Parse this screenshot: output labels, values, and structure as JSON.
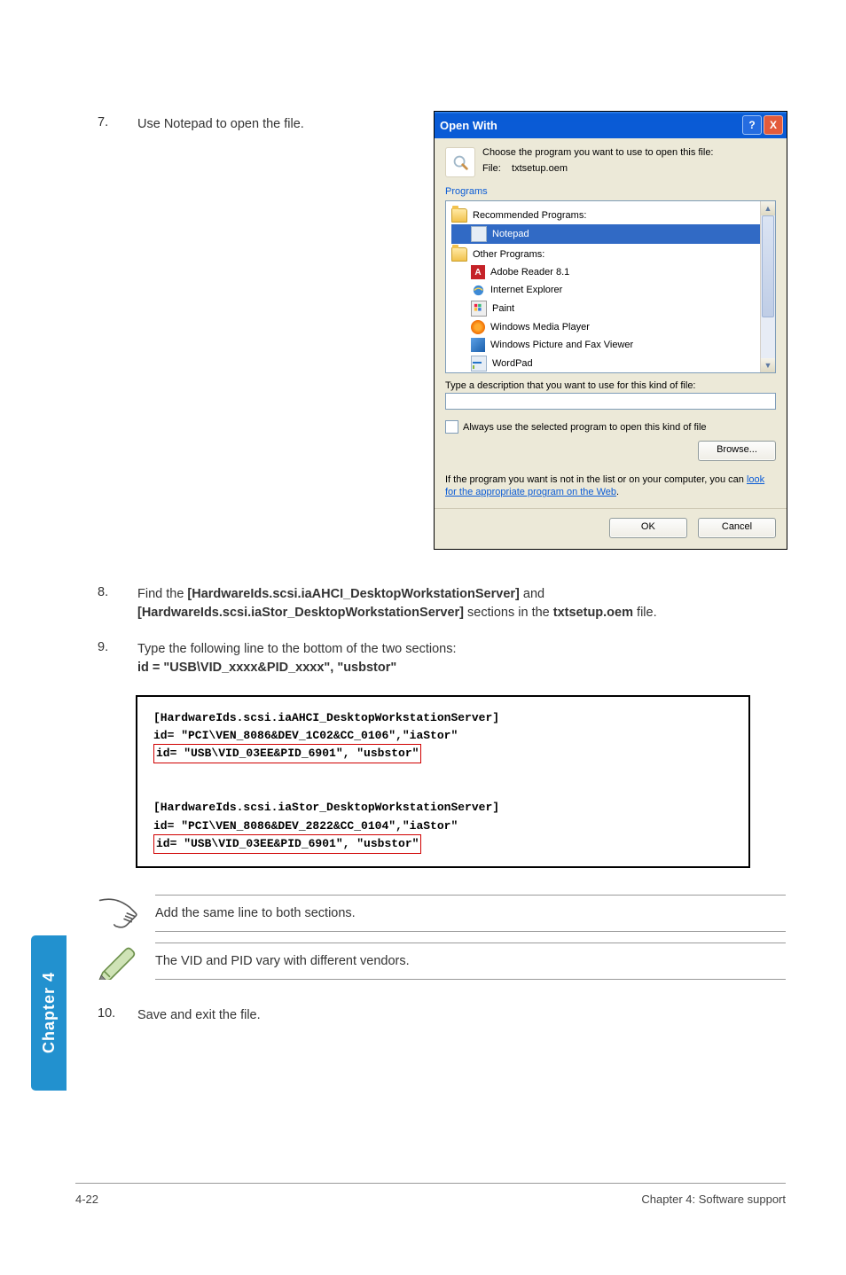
{
  "steps": {
    "s7": {
      "num": "7.",
      "text": "Use Notepad to open the file."
    },
    "s8": {
      "num": "8.",
      "before": "Find the ",
      "b1": "[HardwareIds.scsi.iaAHCI_DesktopWorkstationServer]",
      "mid": " and ",
      "b2": "[HardwareIds.scsi.iaStor_DesktopWorkstationServer]",
      "after1": " sections in the ",
      "b3": "txtsetup.oem",
      "after2": " file."
    },
    "s9": {
      "num": "9.",
      "line1": "Type the following line to the bottom of the two sections:",
      "line2": "id = \"USB\\VID_xxxx&PID_xxxx\", \"usbstor\""
    },
    "s10": {
      "num": "10.",
      "text": "Save and exit the file."
    }
  },
  "dialog": {
    "title": "Open With",
    "help": "?",
    "close": "X",
    "choose": "Choose the program you want to use to open this file:",
    "file_label": "File:",
    "file_name": "txtsetup.oem",
    "programs_label": "Programs",
    "recommended": "Recommended Programs:",
    "notepad": "Notepad",
    "other": "Other Programs:",
    "adobe": "Adobe Reader 8.1",
    "ie": "Internet Explorer",
    "paint": "Paint",
    "wmp": "Windows Media Player",
    "wpfv": "Windows Picture and Fax Viewer",
    "wordpad": "WordPad",
    "desc": "Type a description that you want to use for this kind of file:",
    "always": "Always use the selected program to open this kind of file",
    "browse": "Browse...",
    "help_line1": "If the program you want is not in the list or on your computer, you can ",
    "help_link": "look for the appropriate program on the Web",
    "help_line2": ".",
    "ok": "OK",
    "cancel": "Cancel"
  },
  "code": {
    "h1": "[HardwareIds.scsi.iaAHCI_DesktopWorkstationServer]",
    "l1": "id= \"PCI\\VEN_8086&DEV_1C02&CC_0106\",\"iaStor\"",
    "hl1": "id= \"USB\\VID_03EE&PID_6901\", \"usbstor\"",
    "h2": "[HardwareIds.scsi.iaStor_DesktopWorkstationServer]",
    "l2": "id= \"PCI\\VEN_8086&DEV_2822&CC_0104\",\"iaStor\"",
    "hl2": "id= \"USB\\VID_03EE&PID_6901\", \"usbstor\""
  },
  "notes": {
    "n1": "Add the same line to both sections.",
    "n2": "The VID and PID vary with different vendors."
  },
  "side_tab": "Chapter 4",
  "footer": {
    "left": "4-22",
    "right": "Chapter 4: Software support"
  }
}
